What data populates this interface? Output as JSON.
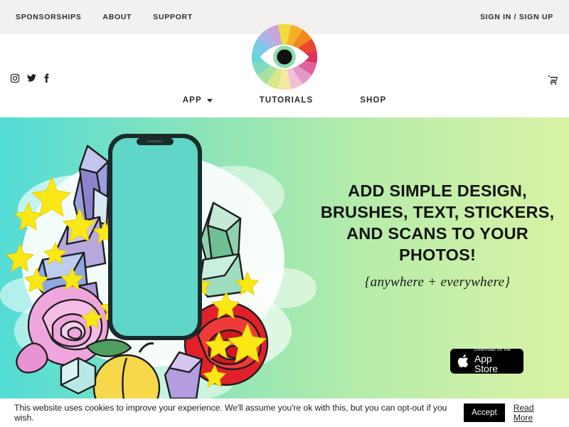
{
  "topbar": {
    "links": [
      {
        "label": "SPONSORSHIPS",
        "name": "sponsorships"
      },
      {
        "label": "ABOUT",
        "name": "about"
      },
      {
        "label": "SUPPORT",
        "name": "support"
      }
    ],
    "account_label": "SIGN IN / SIGN UP"
  },
  "social": [
    {
      "name": "instagram-icon",
      "label": "Instagram"
    },
    {
      "name": "twitter-icon",
      "label": "Twitter"
    },
    {
      "name": "facebook-icon",
      "label": "Facebook"
    }
  ],
  "logo": {
    "name": "rainbow-eye-logo",
    "alt": "Rainbow eye logo",
    "wedge_colors": [
      "#f0dc3c",
      "#f5b02a",
      "#f0881e",
      "#e8452f",
      "#e03060",
      "#e2609a",
      "#e39ac6",
      "#f0c0d8",
      "#f7e8a0",
      "#d7e98a",
      "#a8e2a0",
      "#7ddcc0",
      "#66d4d8",
      "#7cc8e8",
      "#a9b6e6",
      "#c9a4dd"
    ],
    "iris_color": "#8ddcae",
    "pupil_color": "#111111"
  },
  "cart": {
    "name": "shopping-cart-icon",
    "label": "Cart"
  },
  "mainnav": {
    "items": [
      {
        "label": "APP",
        "name": "app",
        "has_dropdown": true
      },
      {
        "label": "TUTORIALS",
        "name": "tutorials",
        "has_dropdown": false
      },
      {
        "label": "SHOP",
        "name": "shop",
        "has_dropdown": false
      }
    ]
  },
  "hero": {
    "headline": "ADD SIMPLE DESIGN, BRUSHES, TEXT, STICKERS, AND SCANS TO YOUR PHOTOS!",
    "subhead": "{anywhere + everywhere}",
    "gradient_from": "#53dcd6",
    "gradient_to": "#d8f2a4",
    "appstore": {
      "small_label": "Download on the",
      "big_label": "App Store",
      "icon_name": "apple-logo-icon"
    },
    "artwork": {
      "name": "phone-with-crystals-flowers-stars-illustration",
      "phone_screen_color": "#5fd6c8",
      "phone_body_color": "#1b2b2b",
      "elements": [
        "smartphone",
        "purple-crystals",
        "green-crystals",
        "pink-rose",
        "red-rose",
        "peach",
        "yellow-stars",
        "white-paint-splash"
      ]
    }
  },
  "cookie": {
    "message": "This website uses cookies to improve your experience. We'll assume you're ok with this, but you can opt-out if you wish.",
    "accept_label": "Accept",
    "more_label": "Read More"
  }
}
